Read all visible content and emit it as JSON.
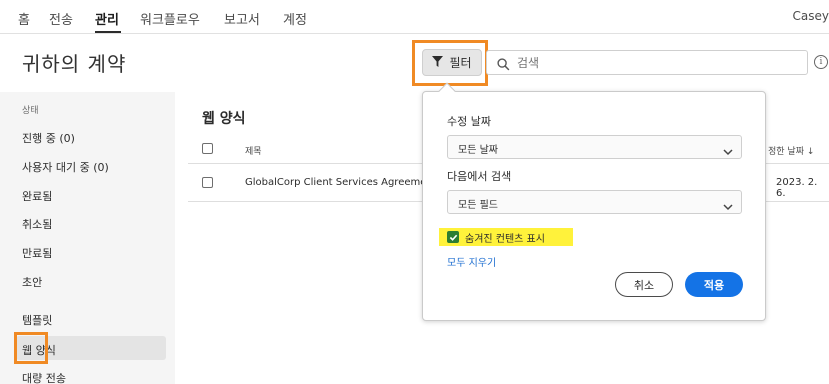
{
  "nav": {
    "items": [
      {
        "label": "홈"
      },
      {
        "label": "전송"
      },
      {
        "label": "관리"
      },
      {
        "label": "워크플로우"
      },
      {
        "label": "보고서"
      },
      {
        "label": "계정"
      }
    ],
    "active_index": 2,
    "user": "Casey"
  },
  "header": {
    "title": "귀하의 계약",
    "filter_label": "필터",
    "search_placeholder": "검색"
  },
  "sidebar": {
    "status_heading": "상태",
    "items": [
      {
        "label": "진행 중 (0)"
      },
      {
        "label": "사용자 대기 중 (0)"
      },
      {
        "label": "완료됨"
      },
      {
        "label": "취소됨"
      },
      {
        "label": "만료됨"
      },
      {
        "label": "초안"
      },
      {
        "label": "템플릿"
      },
      {
        "label": "웹 양식"
      },
      {
        "label": "대량 전송"
      }
    ],
    "selected": "웹 양식"
  },
  "main": {
    "section_title": "웹 양식",
    "columns": {
      "title": "제목",
      "modified": "정한 날짜"
    },
    "rows": [
      {
        "title": "GlobalCorp Client Services Agreement",
        "date": "2023. 2. 6."
      }
    ]
  },
  "filter_popover": {
    "modified_date_label": "수정 날짜",
    "modified_date_value": "모든 날짜",
    "search_in_label": "다음에서 검색",
    "search_in_value": "모든 필드",
    "show_hidden_label": "숨겨진 컨텐츠 표시",
    "show_hidden_checked": true,
    "clear_all": "모두 지우기",
    "cancel": "취소",
    "apply": "적용"
  },
  "colors": {
    "accent_blue": "#1473e6",
    "highlight_orange": "#f08a24",
    "highlight_yellow": "#fff23b",
    "check_green": "#2d7d32"
  }
}
